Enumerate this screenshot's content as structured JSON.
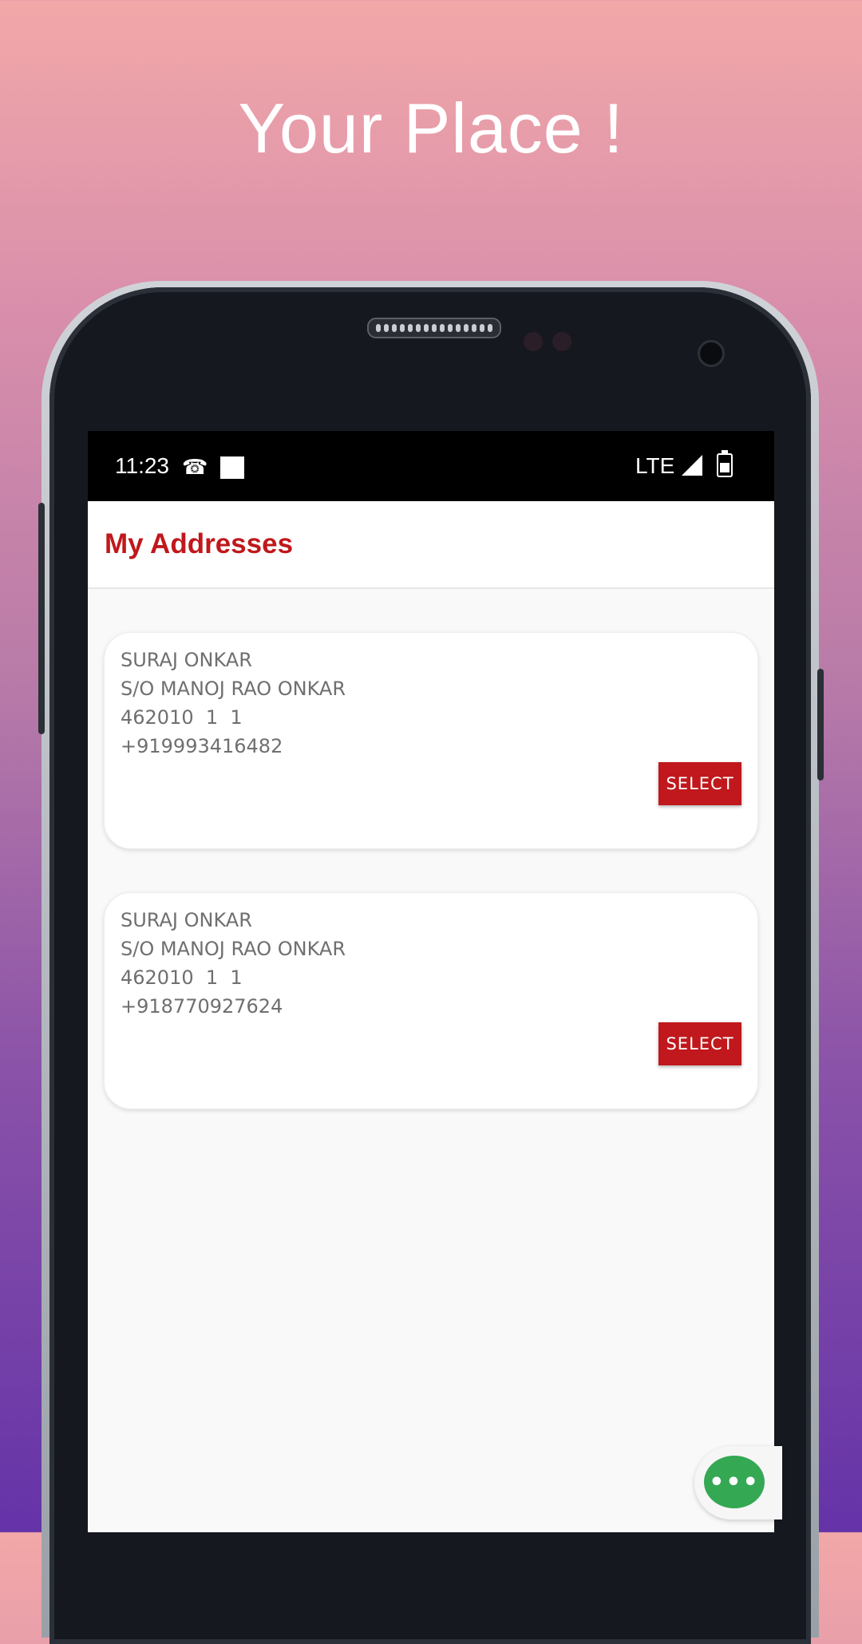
{
  "headline": "Your Place !",
  "statusbar": {
    "time": "11:23",
    "network": "LTE",
    "icons": [
      "missed-call-icon",
      "notification-square-icon",
      "signal-icon",
      "battery-icon"
    ]
  },
  "appbar": {
    "title": "My Addresses",
    "title_color": "#c0181c"
  },
  "addresses": [
    {
      "name": "SURAJ ONKAR",
      "relation": "S/O MANOJ RAO ONKAR",
      "pin": "462010  1  1",
      "phone": "+919993416482",
      "button": "SELECT"
    },
    {
      "name": "SURAJ ONKAR",
      "relation": "S/O MANOJ RAO ONKAR",
      "pin": "462010  1  1",
      "phone": "+918770927624",
      "button": "SELECT"
    }
  ],
  "fab": {
    "icon": "more-dots-icon",
    "label": "•••",
    "color": "#34a853"
  },
  "colors": {
    "accent": "#c0181c",
    "background_top": "#f2a8a8",
    "background_bottom": "#6533a8"
  }
}
